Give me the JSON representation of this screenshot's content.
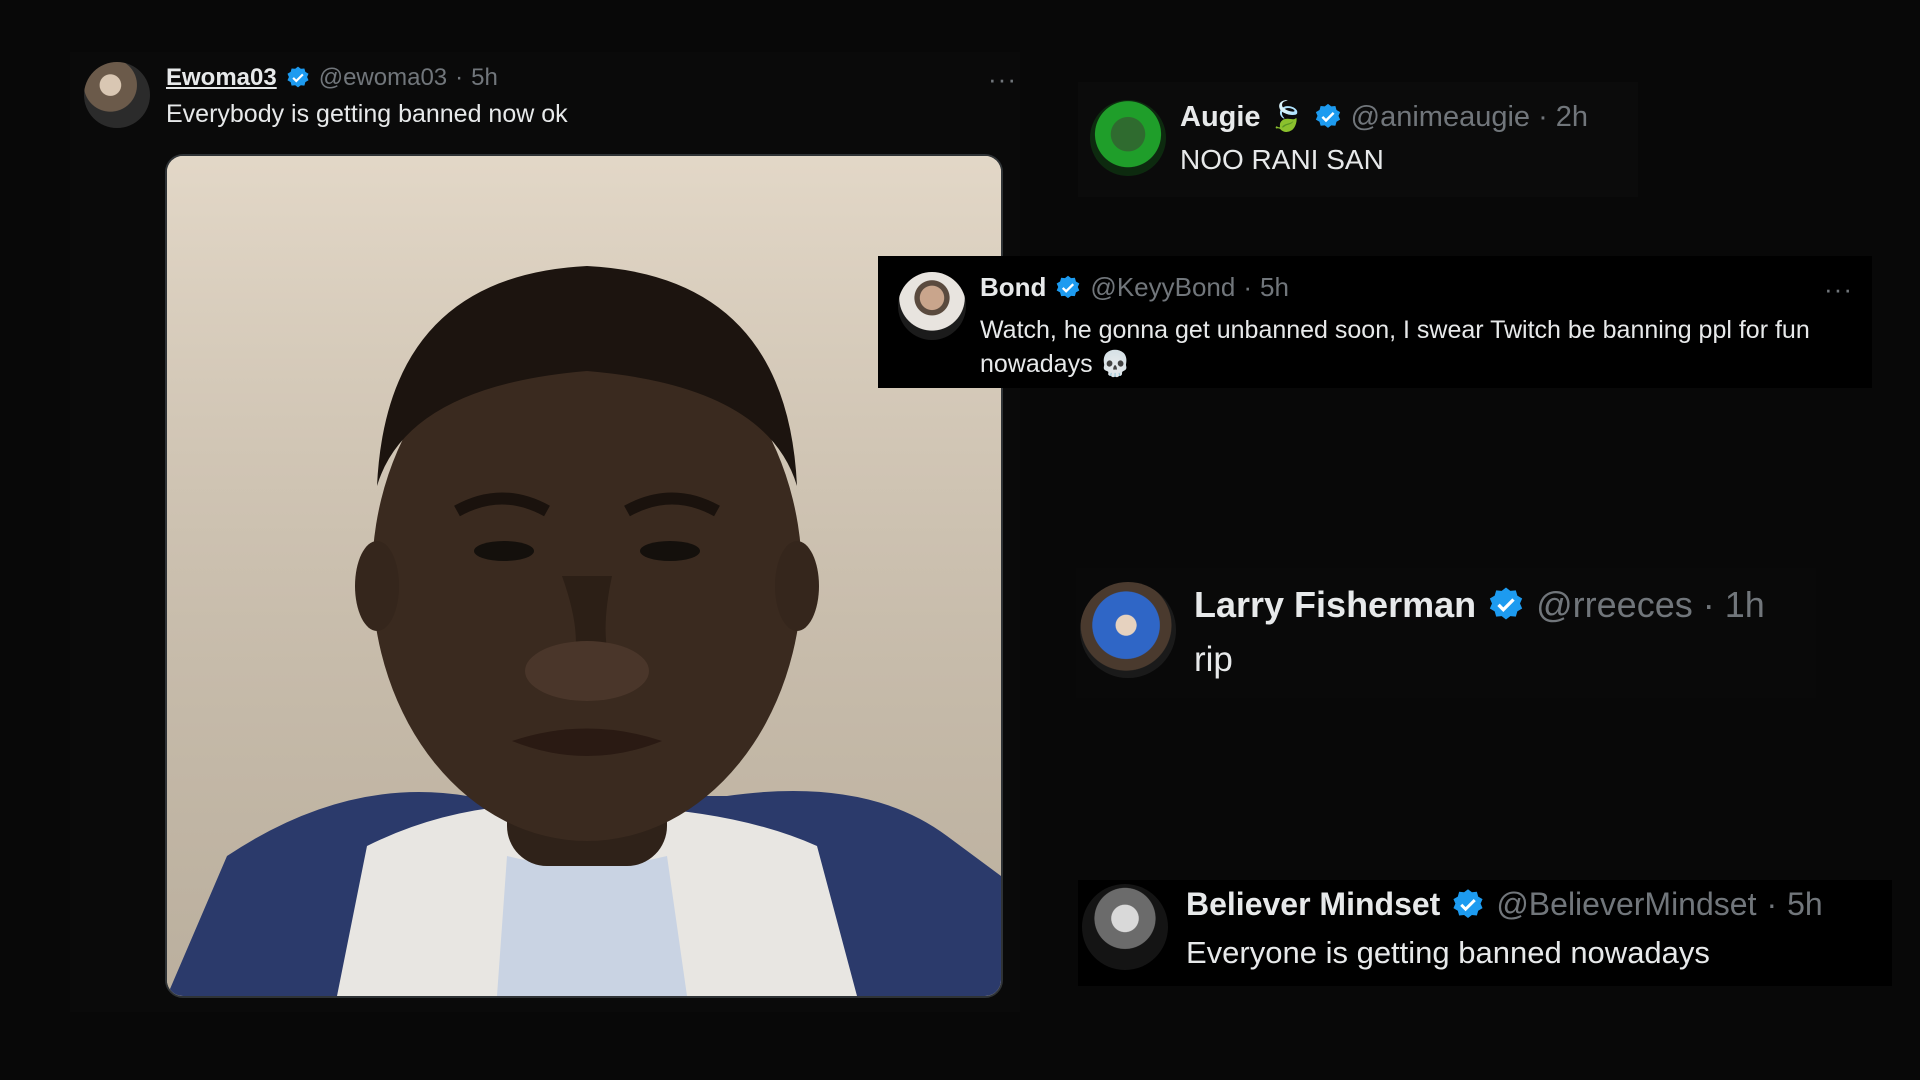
{
  "colors": {
    "background": "#080808",
    "verified": "#1d9bf0",
    "muted": "#71767b",
    "text": "#e7e9ea"
  },
  "main_post": {
    "name": "Ewoma03",
    "handle": "@ewoma03",
    "sep": "·",
    "time": "5h",
    "text": "Everybody is getting banned now ok",
    "more": "···",
    "image_icon": "reaction-face-photo"
  },
  "reply_augie": {
    "name": "Augie",
    "emoji": "🍃",
    "handle": "@animeaugie",
    "sep": "·",
    "time": "2h",
    "text": "NOO RANI SAN"
  },
  "reply_bond": {
    "name": "Bond",
    "handle": "@KeyyBond",
    "sep": "·",
    "time": "5h",
    "text": "Watch, he gonna get unbanned soon, I swear Twitch be banning ppl for fun nowadays 💀",
    "more": "···"
  },
  "reply_larry": {
    "name": "Larry Fisherman",
    "handle": "@rreeces",
    "sep": "·",
    "time": "1h",
    "text": "rip"
  },
  "reply_believer": {
    "name": "Believer Mindset",
    "handle": "@BelieverMindset",
    "sep": "·",
    "time": "5h",
    "text": "Everyone is getting banned nowadays"
  }
}
